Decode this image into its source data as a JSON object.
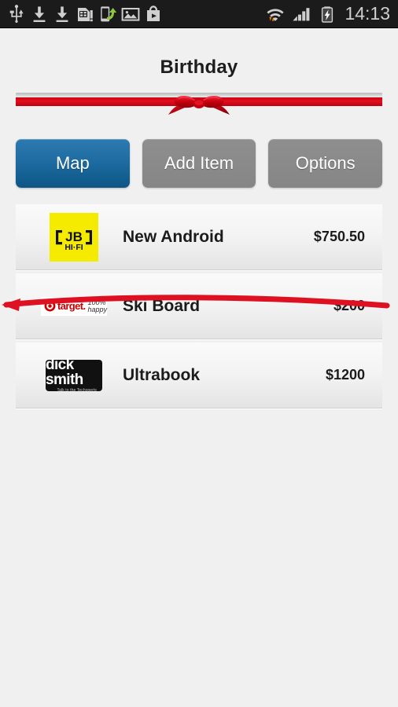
{
  "status_bar": {
    "icons_left": [
      {
        "name": "usb-icon",
        "label": "USB"
      },
      {
        "name": "download-icon",
        "label": "Download"
      },
      {
        "name": "download-icon-2",
        "label": "Download"
      },
      {
        "name": "sim-card-icon",
        "label": "SIM card"
      },
      {
        "name": "share-device-icon",
        "label": "Share"
      },
      {
        "name": "image-icon",
        "label": "Screenshot"
      },
      {
        "name": "play-store-icon",
        "label": "Play Store"
      }
    ],
    "icons_right": [
      {
        "name": "wifi-icon",
        "label": "Wi-Fi"
      },
      {
        "name": "signal-icon",
        "label": "Signal"
      },
      {
        "name": "battery-charging-icon",
        "label": "Battery charging"
      }
    ],
    "clock": "14:13"
  },
  "header": {
    "title": "Birthday"
  },
  "ribbon": {
    "name": "birthday-ribbon-bow",
    "ribbon_color": "#d00a14",
    "bar_color": "#c4c4c4"
  },
  "toolbar": {
    "buttons": [
      {
        "label": "Map",
        "name": "map-button",
        "style": "primary"
      },
      {
        "label": "Add Item",
        "name": "add-item-button",
        "style": "default"
      },
      {
        "label": "Options",
        "name": "options-button",
        "style": "default"
      }
    ]
  },
  "list": {
    "items": [
      {
        "name": "New Android",
        "price": "$750.50",
        "store": "JB HI-FI",
        "store_logo": "jbhifi-logo",
        "logo_text_top": "JB",
        "logo_text_bottom": "HI·FI",
        "purchased": false
      },
      {
        "name": "Ski Board",
        "price": "$200",
        "store": "Target",
        "store_logo": "target-logo",
        "logo_text_top": "target.",
        "logo_text_bottom": "100% happy",
        "purchased": true
      },
      {
        "name": "Ultrabook",
        "price": "$1200",
        "store": "dick smith",
        "store_logo": "dicksmith-logo",
        "logo_text_top": "dick smith",
        "logo_text_bottom": "Talk to the Techxperts",
        "purchased": false
      }
    ]
  },
  "colors": {
    "accent_blue": "#1e6ca2",
    "button_grey": "#8a8a8a",
    "ribbon_red": "#d00a14",
    "jbhifi_yellow": "#f5eb00",
    "target_red": "#cc0000",
    "page_background": "#f0f0f0",
    "status_bar_background": "#1b1b1b"
  }
}
